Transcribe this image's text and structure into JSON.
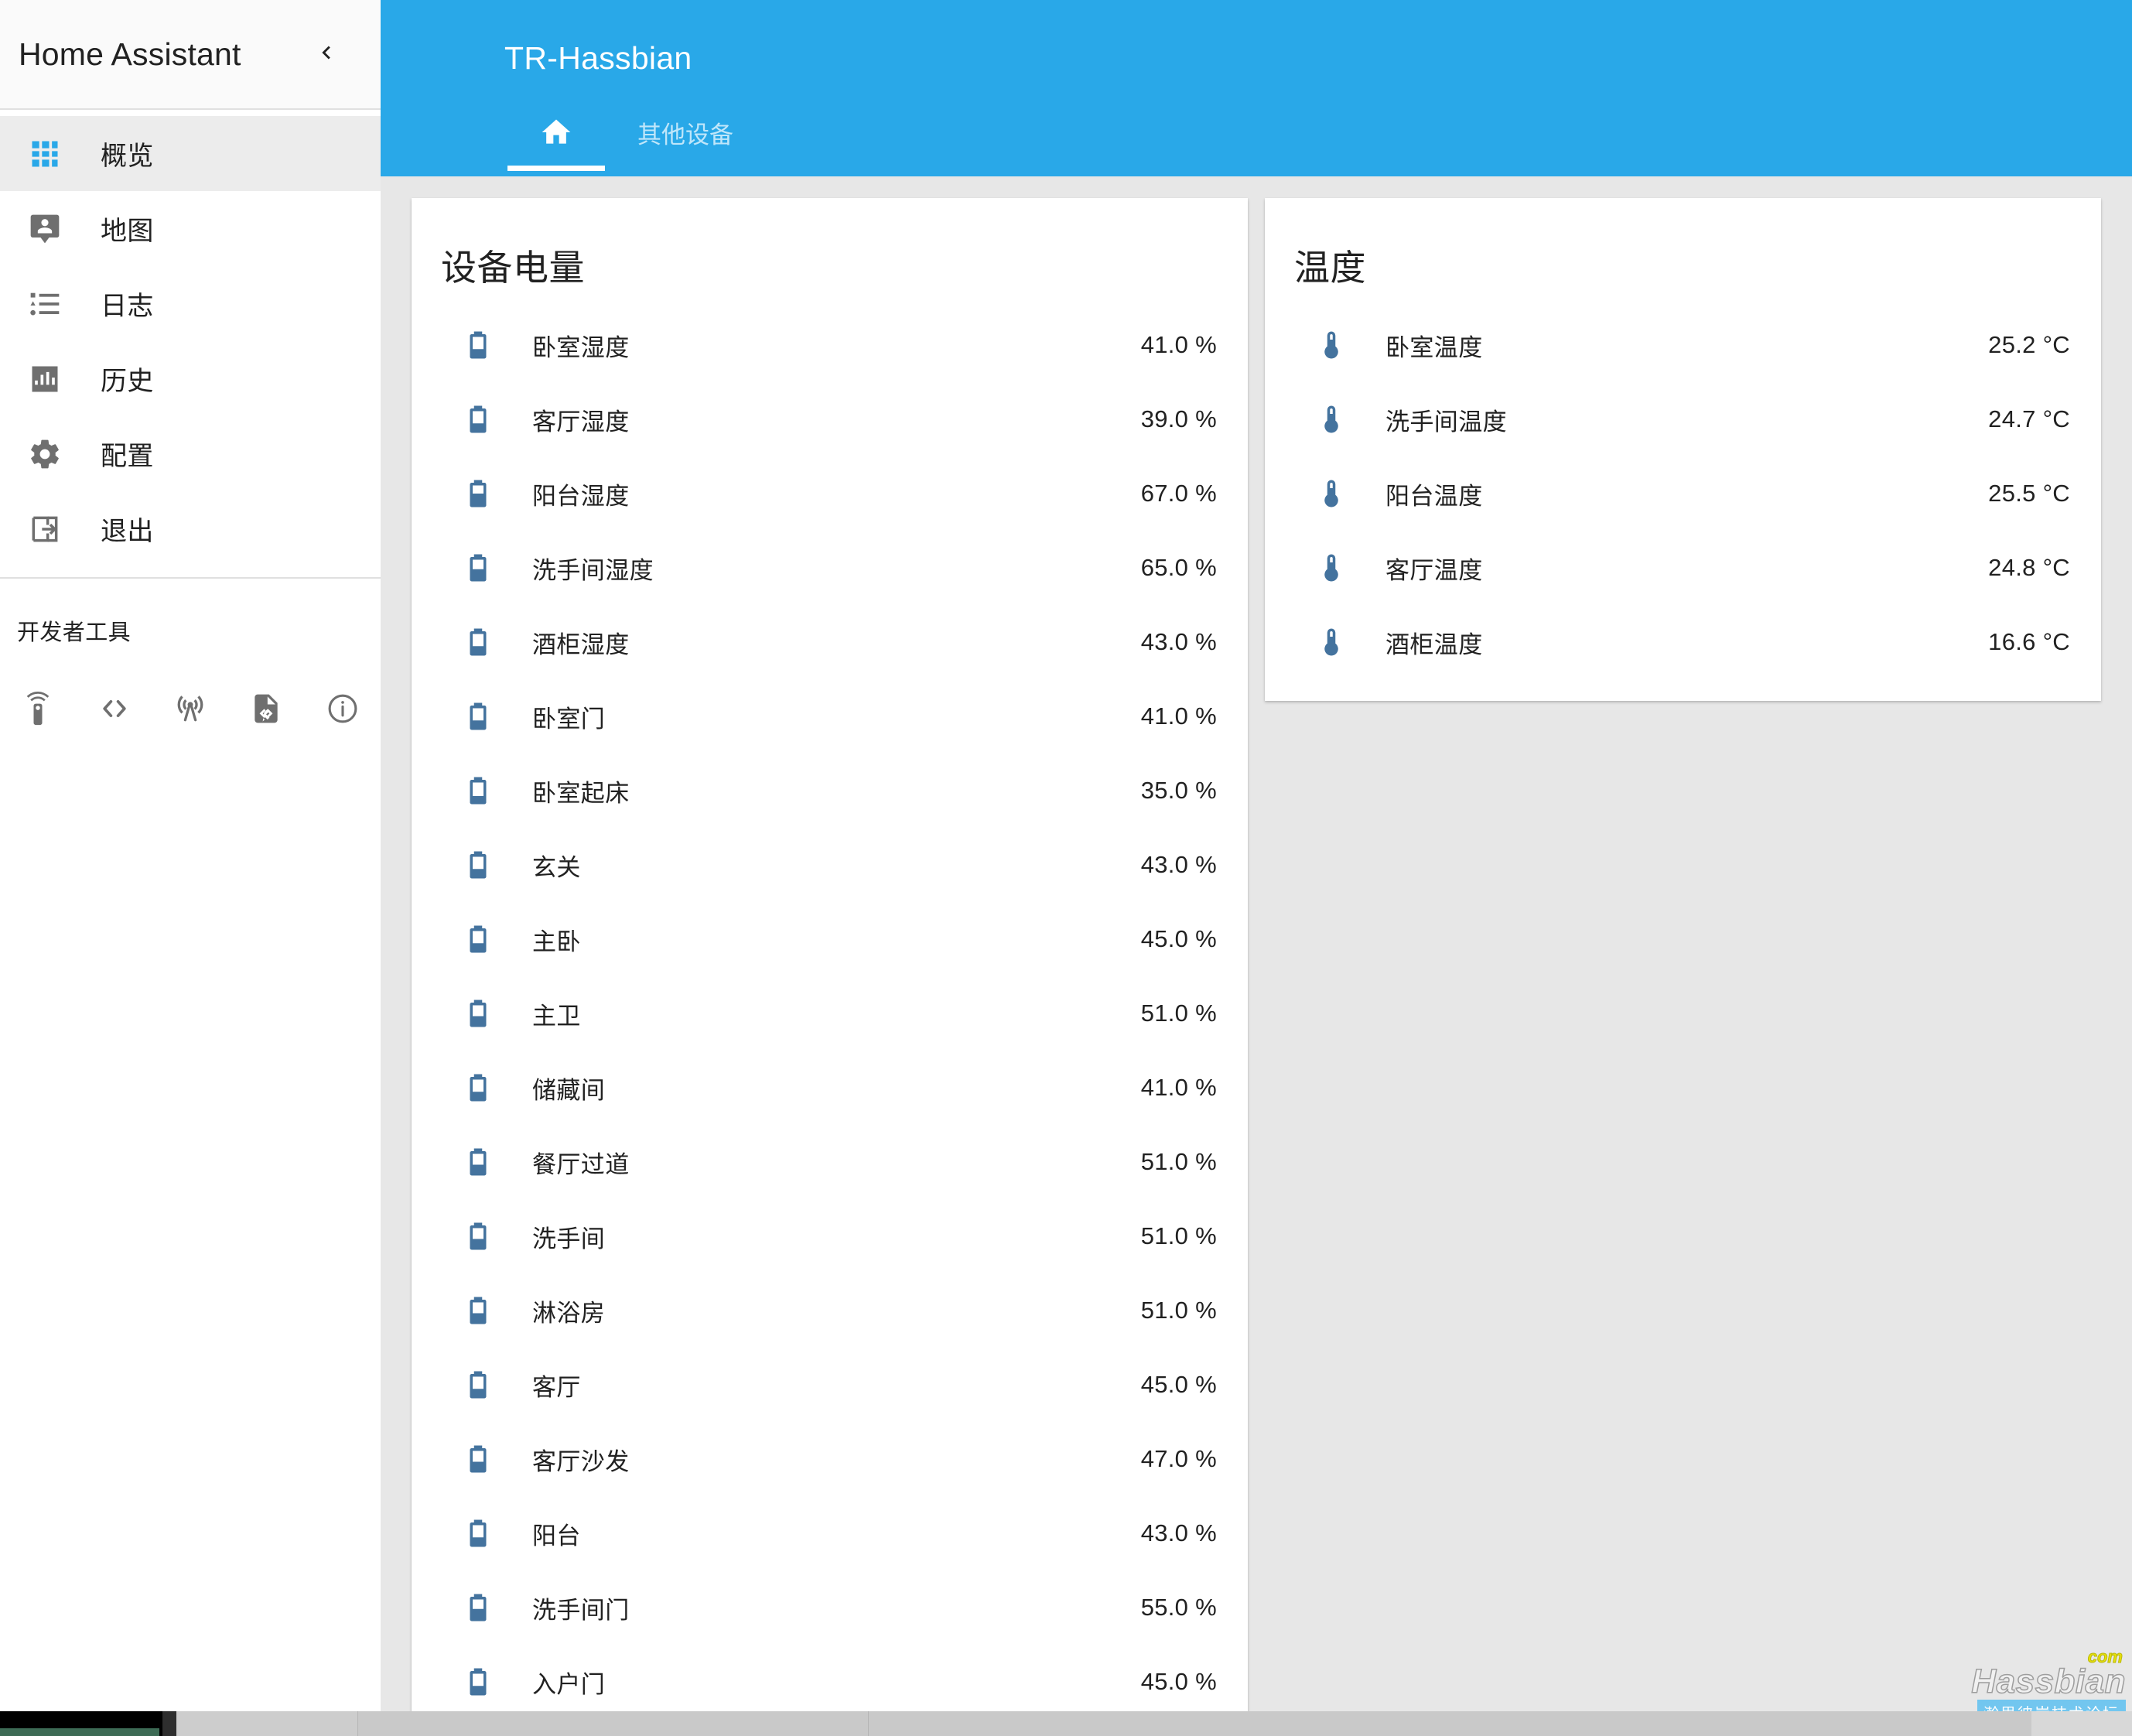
{
  "sidebar": {
    "title": "Home Assistant",
    "collapse_icon": "chevron-left-icon",
    "items": [
      {
        "label": "概览",
        "icon": "grid-icon",
        "active": true
      },
      {
        "label": "地图",
        "icon": "map-marker-account-icon",
        "active": false
      },
      {
        "label": "日志",
        "icon": "format-list-bulleted-icon",
        "active": false
      },
      {
        "label": "历史",
        "icon": "chart-box-icon",
        "active": false
      },
      {
        "label": "配置",
        "icon": "gear-icon",
        "active": false
      },
      {
        "label": "退出",
        "icon": "logout-icon",
        "active": false
      }
    ],
    "devtools": {
      "title": "开发者工具",
      "icons": [
        "remote-icon",
        "code-tags-icon",
        "broadcast-icon",
        "file-code-icon",
        "information-outline-icon"
      ]
    }
  },
  "appbar": {
    "title": "TR-Hassbian",
    "tabs": [
      {
        "label": "",
        "icon": "home-icon",
        "active": true
      },
      {
        "label": "其他设备",
        "icon": "",
        "active": false
      }
    ]
  },
  "cards": [
    {
      "title": "设备电量",
      "icon": "battery-icon",
      "rows": [
        {
          "name": "卧室湿度",
          "value": "41.0 %"
        },
        {
          "name": "客厅湿度",
          "value": "39.0 %"
        },
        {
          "name": "阳台湿度",
          "value": "67.0 %"
        },
        {
          "name": "洗手间湿度",
          "value": "65.0 %"
        },
        {
          "name": "酒柜湿度",
          "value": "43.0 %"
        },
        {
          "name": "卧室门",
          "value": "41.0 %"
        },
        {
          "name": "卧室起床",
          "value": "35.0 %"
        },
        {
          "name": "玄关",
          "value": "43.0 %"
        },
        {
          "name": "主卧",
          "value": "45.0 %"
        },
        {
          "name": "主卫",
          "value": "51.0 %"
        },
        {
          "name": "储藏间",
          "value": "41.0 %"
        },
        {
          "name": "餐厅过道",
          "value": "51.0 %"
        },
        {
          "name": "洗手间",
          "value": "51.0 %"
        },
        {
          "name": "淋浴房",
          "value": "51.0 %"
        },
        {
          "name": "客厅",
          "value": "45.0 %"
        },
        {
          "name": "客厅沙发",
          "value": "47.0 %"
        },
        {
          "name": "阳台",
          "value": "43.0 %"
        },
        {
          "name": "洗手间门",
          "value": "55.0 %"
        },
        {
          "name": "入户门",
          "value": "45.0 %"
        }
      ]
    },
    {
      "title": "温度",
      "icon": "thermometer-icon",
      "rows": [
        {
          "name": "卧室温度",
          "value": "25.2 °C"
        },
        {
          "name": "洗手间温度",
          "value": "24.7 °C"
        },
        {
          "name": "阳台温度",
          "value": "25.5 °C"
        },
        {
          "name": "客厅温度",
          "value": "24.8 °C"
        },
        {
          "name": "酒柜温度",
          "value": "16.6 °C"
        }
      ]
    }
  ],
  "watermark": {
    "com": "com",
    "name": "Hassbian",
    "sub": "瀚思彼岸技术论坛"
  },
  "colors": {
    "accent": "#29a8e8",
    "icon_blue": "#44739e",
    "sidebar_active_bg": "#ececec",
    "page_bg": "#e7e7e7"
  }
}
